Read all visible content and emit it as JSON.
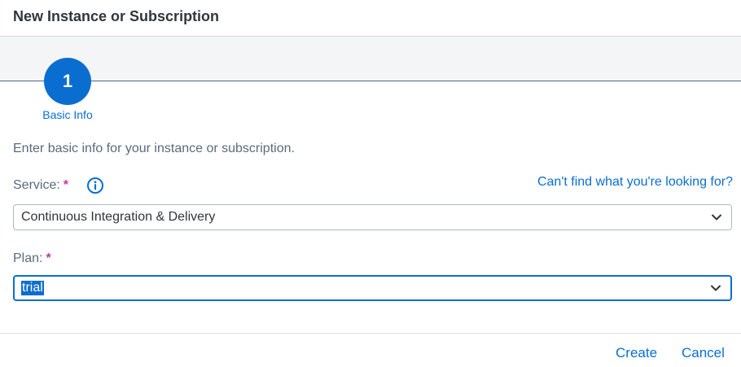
{
  "dialog": {
    "title": "New Instance or Subscription"
  },
  "wizard": {
    "step_number": "1",
    "step_label": "Basic Info"
  },
  "intro": "Enter basic info for your instance or subscription.",
  "service": {
    "label": "Service:",
    "required_mark": "*",
    "help_link": "Can't find what you're looking for?",
    "value": "Continuous Integration & Delivery"
  },
  "plan": {
    "label": "Plan:",
    "required_mark": "*",
    "value": "trial"
  },
  "footer": {
    "create_label": "Create",
    "cancel_label": "Cancel"
  },
  "colors": {
    "accent": "#0a6ed1",
    "required": "#c0399f"
  },
  "icons": {
    "info": "info-icon",
    "chevron": "chevron-down-icon"
  }
}
